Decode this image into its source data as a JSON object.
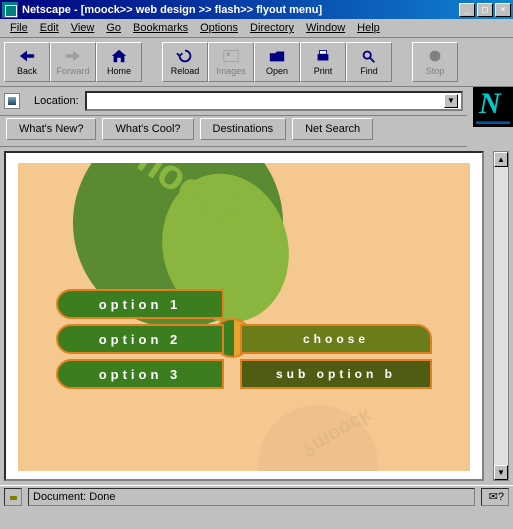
{
  "window": {
    "title": "Netscape - [moock>> web design >> flash>> flyout menu]"
  },
  "menu": {
    "file": "File",
    "edit": "Edit",
    "view": "View",
    "go": "Go",
    "bookmarks": "Bookmarks",
    "options": "Options",
    "directory": "Directory",
    "window": "Window",
    "help": "Help"
  },
  "toolbar": {
    "back": "Back",
    "forward": "Forward",
    "home": "Home",
    "reload": "Reload",
    "images": "Images",
    "open": "Open",
    "print": "Print",
    "find": "Find",
    "stop": "Stop"
  },
  "location": {
    "label": "Location:",
    "value": ""
  },
  "directory": {
    "whats_new": "What's New?",
    "whats_cool": "What's Cool?",
    "destinations": "Destinations",
    "net_search": "Net Search"
  },
  "flash": {
    "logo_text": "?moock",
    "options": [
      "option 1",
      "option 2",
      "option 3"
    ],
    "choose_label": "choose",
    "suboption_label": "sub option b",
    "reflection_text": "?moock"
  },
  "status": {
    "document": "Document: Done",
    "mail_glyph": "✉?"
  },
  "winbtns": {
    "min": "_",
    "max": "□",
    "close": "×"
  }
}
